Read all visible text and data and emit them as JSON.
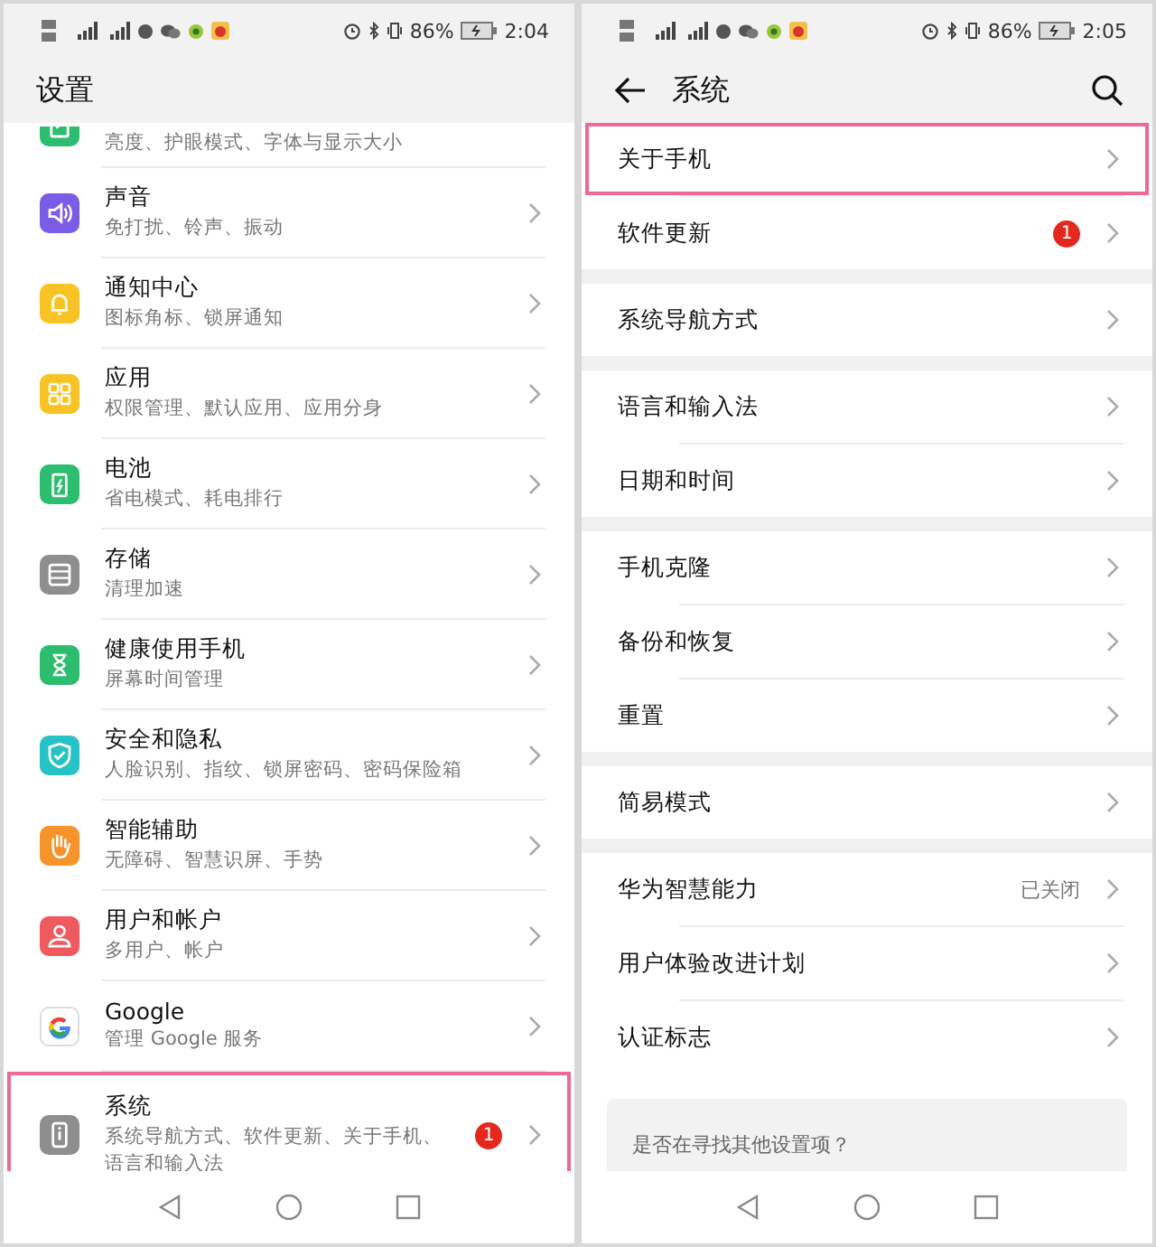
{
  "screens": [
    {
      "status_bar": {
        "battery": "86%",
        "time": "2:04"
      },
      "header": {
        "kind": "main",
        "title": "设置"
      },
      "sections": [
        {
          "items": [
            {
              "kind": "display",
              "subtitle": "亮度、护眼模式、字体与显示大小",
              "highlighted": false
            },
            {
              "kind": "sound",
              "title": "声音",
              "subtitle": "免打扰、铃声、振动",
              "highlighted": false
            },
            {
              "kind": "bell",
              "title": "通知中心",
              "subtitle": "图标角标、锁屏通知",
              "highlighted": false
            },
            {
              "kind": "apps",
              "title": "应用",
              "subtitle": "权限管理、默认应用、应用分身",
              "highlighted": false
            },
            {
              "kind": "battery",
              "title": "电池",
              "subtitle": "省电模式、耗电排行",
              "highlighted": false
            },
            {
              "kind": "storage",
              "title": "存储",
              "subtitle": "清理加速",
              "highlighted": false
            },
            {
              "kind": "hourglass",
              "title": "健康使用手机",
              "subtitle": "屏幕时间管理",
              "highlighted": false
            },
            {
              "kind": "shield",
              "title": "安全和隐私",
              "subtitle": "人脸识别、指纹、锁屏密码、密码保险箱",
              "highlighted": false
            },
            {
              "kind": "hand",
              "title": "智能辅助",
              "subtitle": "无障碍、智慧识屏、手势",
              "highlighted": false
            },
            {
              "kind": "user",
              "title": "用户和帐户",
              "subtitle": "多用户、帐户",
              "highlighted": false
            },
            {
              "kind": "google",
              "title": "Google",
              "subtitle": "管理 Google 服务",
              "highlighted": false
            },
            {
              "kind": "system",
              "title": "系统",
              "subtitle": "系统导航方式、软件更新、关于手机、语言和输入法",
              "badge": "1",
              "highlighted": true
            }
          ]
        }
      ]
    },
    {
      "status_bar": {
        "battery": "86%",
        "time": "2:05"
      },
      "header": {
        "kind": "sub",
        "title": "系统"
      },
      "sections": [
        {
          "items": [
            {
              "title": "关于手机",
              "highlighted": true
            },
            {
              "title": "软件更新",
              "badge": "1",
              "highlighted": false
            }
          ]
        },
        {
          "items": [
            {
              "title": "系统导航方式",
              "highlighted": false
            }
          ]
        },
        {
          "items": [
            {
              "title": "语言和输入法",
              "highlighted": false
            },
            {
              "title": "日期和时间",
              "highlighted": false
            }
          ]
        },
        {
          "items": [
            {
              "title": "手机克隆",
              "highlighted": false
            },
            {
              "title": "备份和恢复",
              "highlighted": false
            },
            {
              "title": "重置",
              "highlighted": false
            }
          ]
        },
        {
          "items": [
            {
              "title": "简易模式",
              "highlighted": false
            }
          ]
        },
        {
          "items": [
            {
              "title": "华为智慧能力",
              "value": "已关闭",
              "highlighted": false
            },
            {
              "title": "用户体验改进计划",
              "highlighted": false
            },
            {
              "title": "认证标志",
              "highlighted": false
            }
          ]
        }
      ],
      "suggestion_card": {
        "text": "是否在寻找其他设置项？"
      }
    }
  ]
}
